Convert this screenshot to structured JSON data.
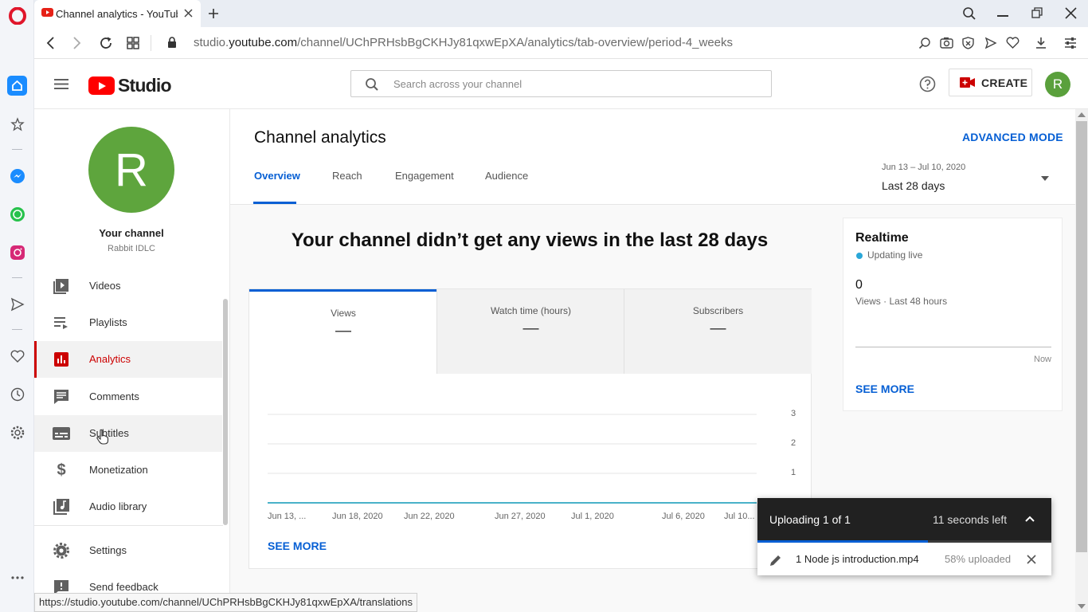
{
  "browser": {
    "tab_title": "Channel analytics - YouTub",
    "url_prefix": "studio.",
    "url_domain": "youtube.com",
    "url_path": "/channel/UChPRHsbBgCKHJy81qxwEpXA/analytics/tab-overview/period-4_weeks",
    "status_url": "https://studio.youtube.com/channel/UChPRHsbBgCKHJy81qxwEpXA/translations"
  },
  "header": {
    "logo_text": "Studio",
    "search_placeholder": "Search across your channel",
    "create_label": "CREATE",
    "avatar_letter": "R"
  },
  "channel": {
    "avatar_letter": "R",
    "title": "Your channel",
    "name": "Rabbit IDLC"
  },
  "nav": {
    "videos": "Videos",
    "playlists": "Playlists",
    "analytics": "Analytics",
    "comments": "Comments",
    "subtitles": "Subtitles",
    "monetization": "Monetization",
    "audio_library": "Audio library",
    "settings": "Settings",
    "send_feedback": "Send feedback"
  },
  "analytics": {
    "title": "Channel analytics",
    "advanced_mode": "ADVANCED MODE",
    "tabs": [
      "Overview",
      "Reach",
      "Engagement",
      "Audience"
    ],
    "date_range": "Jun 13 – Jul 10, 2020",
    "period": "Last 28 days",
    "headline": "Your channel didn’t get any views in the last 28 days",
    "metrics": [
      {
        "label": "Views",
        "value": "—"
      },
      {
        "label": "Watch time (hours)",
        "value": "—"
      },
      {
        "label": "Subscribers",
        "value": "—"
      }
    ],
    "see_more": "SEE MORE"
  },
  "chart_data": {
    "type": "line",
    "x": [
      "Jun 13, ...",
      "Jun 18, 2020",
      "Jun 22, 2020",
      "Jun 27, 2020",
      "Jul 1, 2020",
      "Jul 6, 2020",
      "Jul 10..."
    ],
    "series": [
      {
        "values": [
          0,
          0,
          0,
          0,
          0,
          0,
          0
        ]
      }
    ],
    "yticks": [
      "3",
      "2",
      "1"
    ],
    "ylim": [
      0,
      3
    ],
    "grid": true
  },
  "realtime": {
    "title": "Realtime",
    "status": "Updating live",
    "count": "0",
    "count_label": "Views · Last 48 hours",
    "axis_end": "Now",
    "see_more": "SEE MORE"
  },
  "upload": {
    "header": "Uploading 1 of 1",
    "time_left": "11 seconds left",
    "progress": 0.58,
    "filename": "1 Node js introduction.mp4",
    "status": "58% uploaded"
  },
  "colors": {
    "accent_red": "#cc0000",
    "link_blue": "#065fd4",
    "line_teal": "#4ab2c9",
    "avatar_green": "#5aa03c"
  }
}
